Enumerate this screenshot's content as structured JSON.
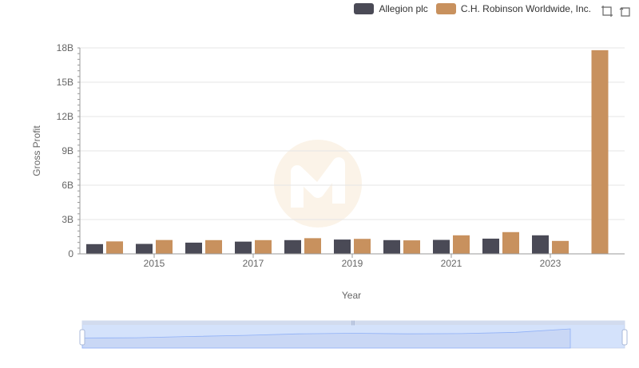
{
  "legend": [
    {
      "name": "Allegion plc",
      "color": "#4a4a56"
    },
    {
      "name": "C.H. Robinson Worldwide, Inc.",
      "color": "#c8915e"
    }
  ],
  "toolbox": {
    "zoom_icon": "zoom-icon",
    "restore_icon": "restore-icon"
  },
  "chart_data": {
    "type": "bar",
    "xlabel": "Year",
    "ylabel": "Gross Profit",
    "ylim": [
      0,
      18000000000
    ],
    "y_ticks": [
      "0",
      "3B",
      "6B",
      "9B",
      "12B",
      "15B",
      "18B"
    ],
    "categories": [
      "2014",
      "2015",
      "2016",
      "2017",
      "2018",
      "2019",
      "2020",
      "2021",
      "2022",
      "2023",
      "2024"
    ],
    "x_tick_labels": [
      "2015",
      "2017",
      "2019",
      "2021",
      "2023"
    ],
    "series": [
      {
        "name": "Allegion plc",
        "color": "#4a4a56",
        "values": [
          850000000,
          870000000,
          980000000,
          1070000000,
          1200000000,
          1250000000,
          1200000000,
          1220000000,
          1330000000,
          1620000000,
          null
        ]
      },
      {
        "name": "C.H. Robinson Worldwide, Inc.",
        "color": "#c8915e",
        "values": [
          1090000000,
          1210000000,
          1200000000,
          1200000000,
          1370000000,
          1310000000,
          1180000000,
          1620000000,
          1900000000,
          1130000000,
          17800000000
        ]
      }
    ],
    "grid": true,
    "legend_position": "top-right",
    "datazoom": true
  }
}
